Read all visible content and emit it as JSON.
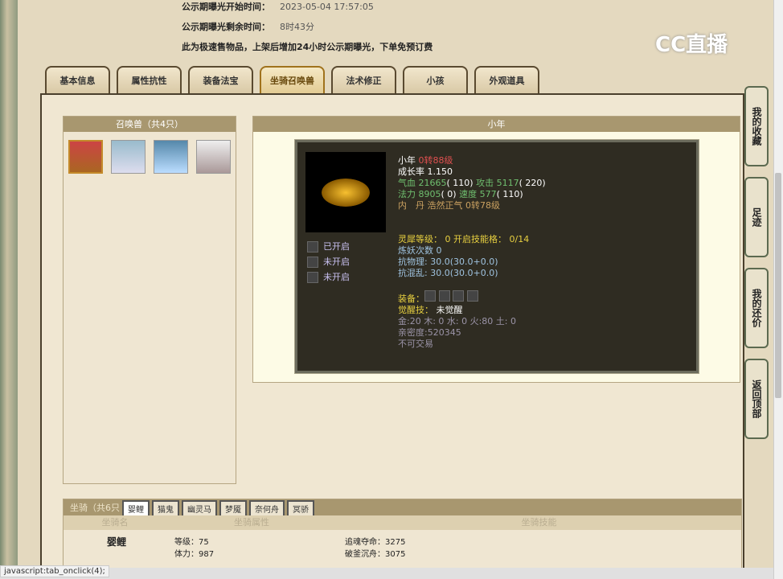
{
  "info": {
    "start_label": "公示期曝光开始时间：",
    "start_value": "2023-05-04 17:57:05",
    "remain_label": "公示期曝光剩余时间：",
    "remain_value": "8时43分",
    "notice": "此为极速售物品，上架后增加24小时公示期曝光，下单免预订费"
  },
  "logo": "CC直播",
  "tabs": [
    "基本信息",
    "属性抗性",
    "装备法宝",
    "坐骑召唤兽",
    "法术修正",
    "小孩",
    "外观道具"
  ],
  "pets": {
    "title": "召唤兽（共4只）",
    "count": 4
  },
  "detail": {
    "title": "小年",
    "name": "小年",
    "level": "0转88级",
    "growth": "成长率 1.150",
    "hp_label": "气血",
    "hp": "21665",
    "hp_add": "( 110)",
    "atk_label": "攻击",
    "atk": "5117",
    "atk_add": "( 220)",
    "mp_label": "法力",
    "mp": "8905",
    "mp_add": "( 0)",
    "spd_label": "速度",
    "spd": "577",
    "spd_add": "( 110)",
    "neidan": "内　丹 浩然正气 0转78级",
    "slots": [
      "已开启",
      "未开启",
      "未开启"
    ],
    "lingxi": "灵犀等级：  0 开启技能格：  0/14",
    "lianyao": "炼妖次数 0",
    "kangwuli": "抗物理: 30.0(30.0+0.0)",
    "kanghunluan": "抗混乱: 30.0(30.0+0.0)",
    "equip": "装备：",
    "juexing_label": "觉醒技：",
    "juexing": "未觉醒",
    "wuxing": "金:20 木: 0 水: 0 火:80 土: 0",
    "qinmi": "亲密度:520345",
    "trade": "不可交易"
  },
  "mount": {
    "title": "坐骑（共6只",
    "tabs": [
      "婴鲤",
      "猫鬼",
      "幽灵马",
      "梦魇",
      "奈何舟",
      "冥骄"
    ],
    "cols": [
      "坐骑名",
      "坐骑属性",
      "坐骑技能"
    ],
    "name": "婴鲤",
    "attrs": [
      "等级：75",
      "体力：987"
    ],
    "skills": [
      "追魂夺命：3275",
      "破釜沉舟：3075"
    ]
  },
  "side": [
    "我的收藏",
    "足迹",
    "我的还价",
    "返回顶部"
  ],
  "status": "javascript:tab_onclick(4);"
}
